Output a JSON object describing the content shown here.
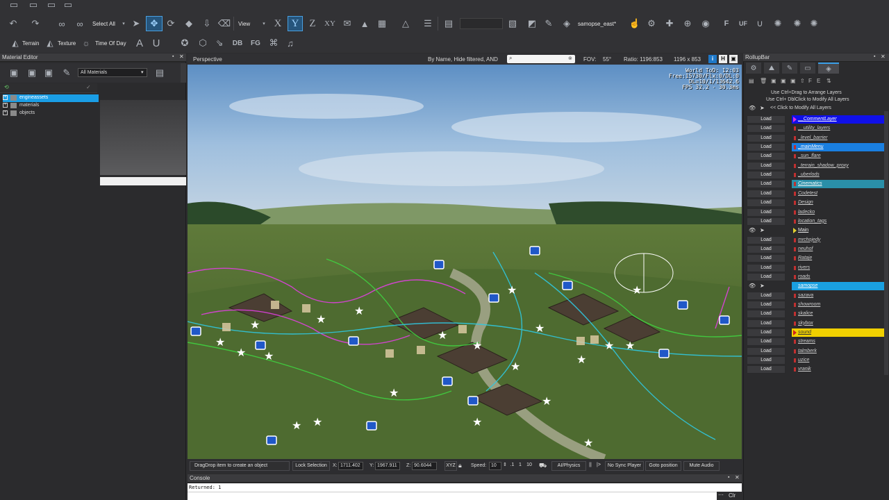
{
  "toolbar": {
    "select_all": "Select All",
    "view": "View",
    "axis_x": "X",
    "axis_y": "Y",
    "axis_z": "Z",
    "axis_xy": "XY",
    "level_name": "samopse_east*",
    "terrain": "Terrain",
    "texture": "Texture",
    "time_of_day": "Time Of Day",
    "btn_a": "A",
    "btn_u": "U",
    "db": "DB",
    "fg": "FG",
    "f": "F",
    "uf": "UF"
  },
  "material_editor": {
    "title": "Material Editor",
    "filter": "All Materials",
    "tree": [
      "engineassets",
      "materials",
      "objects"
    ]
  },
  "viewport": {
    "title": "Perspective",
    "filter_info": "By Name, Hide filtered, AND",
    "fov_label": "FOV:",
    "fov_value": "55°",
    "ratio_label": "Ratio: 1196:853",
    "resolution": "1196 x 853",
    "hud": [
      "World ToD: 12:03",
      "Free:15730/Flx:0/DL:0",
      "DL=10/1/13642.6",
      "FPS 32.2 - 30.3ms"
    ],
    "info_btn": "i",
    "h_btn": "H"
  },
  "statusbar": {
    "dragdrop": "DragDrop item to create an object",
    "lock_selection": "Lock Selection",
    "x_label": "X:",
    "x_value": "1711.402",
    "y_label": "Y:",
    "y_value": "1967.911",
    "z_label": "Z:",
    "z_value": "90.6044",
    "xyz": "XYZ",
    "speed_label": "Speed:",
    "speed_value": "10",
    "speed_01": ".1",
    "speed_1": "1",
    "speed_10": "10",
    "ai_physics": "AI/Physics",
    "pause": "||",
    "next": "|>",
    "no_sync": "No Sync Player",
    "goto": "Goto position",
    "mute": "Mute Audio"
  },
  "console": {
    "title": "Console",
    "output": "Returned: 1",
    "clear": "Clr"
  },
  "rollupbar": {
    "title": "RollupBar",
    "hint1": "Use Ctrl+Drag to Arrange Layers",
    "hint2": "Use Ctrl+ DblClick to Modify All Layers",
    "hint3": "<< Click to Modify All Layers",
    "load_label": "Load",
    "layers": [
      {
        "name": "__CommentLayer",
        "load": true,
        "bg": "#1010e8",
        "mark": "#e030e0",
        "arrow": true
      },
      {
        "name": "__utility_layers",
        "load": true,
        "bg": "",
        "mark": "#c03030",
        "arrow": false
      },
      {
        "name": "_level_barrier",
        "load": true,
        "bg": "",
        "mark": "#c03030",
        "arrow": false
      },
      {
        "name": "_mainMenu",
        "load": true,
        "bg": "#1a7fe0",
        "mark": "#c03030",
        "arrow": false
      },
      {
        "name": "_sun_flare",
        "load": true,
        "bg": "",
        "mark": "#c03030",
        "arrow": false
      },
      {
        "name": "_terrain_shadow_proxy",
        "load": true,
        "bg": "",
        "mark": "#c03030",
        "arrow": false
      },
      {
        "name": "_uberlods",
        "load": true,
        "bg": "",
        "mark": "#c03030",
        "arrow": false
      },
      {
        "name": "Cinematics",
        "load": true,
        "bg": "#2a8fa8",
        "mark": "#c03030",
        "arrow": false
      },
      {
        "name": "Codetest",
        "load": true,
        "bg": "",
        "mark": "#c03030",
        "arrow": false
      },
      {
        "name": "Design",
        "load": true,
        "bg": "",
        "mark": "#c03030",
        "arrow": false
      },
      {
        "name": "ladecko",
        "load": true,
        "bg": "",
        "mark": "#c03030",
        "arrow": false
      },
      {
        "name": "location_tags",
        "load": true,
        "bg": "",
        "mark": "#c03030",
        "arrow": false
      },
      {
        "name": "Main",
        "load": false,
        "bg": "",
        "mark": "#e0d030",
        "arrow": true
      },
      {
        "name": "mrchojedy",
        "load": true,
        "bg": "",
        "mark": "#c03030",
        "arrow": false
      },
      {
        "name": "neuhof",
        "load": true,
        "bg": "",
        "mark": "#c03030",
        "arrow": false
      },
      {
        "name": "Rataje",
        "load": true,
        "bg": "",
        "mark": "#c03030",
        "arrow": false
      },
      {
        "name": "rivers",
        "load": true,
        "bg": "",
        "mark": "#c03030",
        "arrow": false
      },
      {
        "name": "roads",
        "load": true,
        "bg": "",
        "mark": "#c03030",
        "arrow": false
      },
      {
        "name": "samopse",
        "load": false,
        "bg": "#1aa0e0",
        "mark": "#1aa0e0",
        "arrow": false
      },
      {
        "name": "sazava",
        "load": true,
        "bg": "",
        "mark": "#c03030",
        "arrow": false
      },
      {
        "name": "showroom",
        "load": true,
        "bg": "",
        "mark": "#c03030",
        "arrow": false
      },
      {
        "name": "skalice",
        "load": true,
        "bg": "",
        "mark": "#c03030",
        "arrow": false
      },
      {
        "name": "skybox",
        "load": true,
        "bg": "",
        "mark": "#c03030",
        "arrow": false
      },
      {
        "name": "sound",
        "load": true,
        "bg": "#f0d000",
        "mark": "#d02020",
        "arrow": true
      },
      {
        "name": "streams",
        "load": true,
        "bg": "",
        "mark": "#c03030",
        "arrow": false
      },
      {
        "name": "talmberk",
        "load": true,
        "bg": "",
        "mark": "#c03030",
        "arrow": false
      },
      {
        "name": "uzice",
        "load": true,
        "bg": "",
        "mark": "#c03030",
        "arrow": false
      },
      {
        "name": "vranik",
        "load": true,
        "bg": "",
        "mark": "#c03030",
        "arrow": false
      }
    ]
  }
}
